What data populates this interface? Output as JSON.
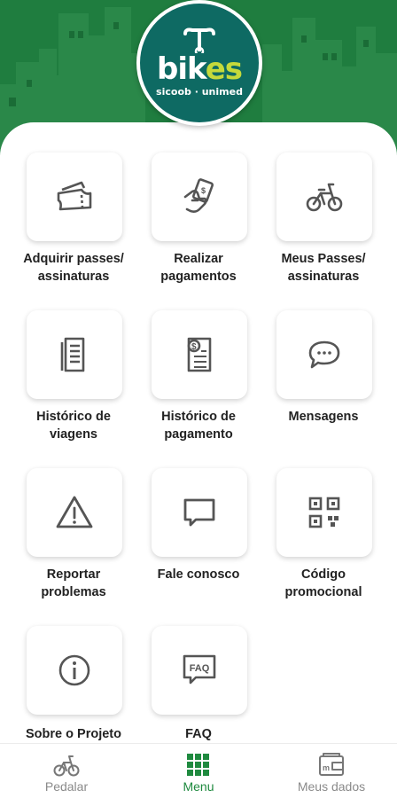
{
  "brand": {
    "logo_word_part1": "bik",
    "logo_word_part2": "es",
    "logo_subtitle": "sicoob · unimed",
    "primary_color": "#1f7d3f",
    "logo_color": "#0e6a63",
    "accent_color": "#c5d93b"
  },
  "menu": {
    "items": [
      {
        "label": "Adquirir passes/\nassinaturas",
        "icon": "ticket-icon"
      },
      {
        "label": "Realizar\npagamentos",
        "icon": "payment-hand-icon"
      },
      {
        "label": "Meus Passes/\nassinaturas",
        "icon": "bicycle-icon"
      },
      {
        "label": "Histórico de\nviagens",
        "icon": "document-icon"
      },
      {
        "label": "Histórico de\npagamento",
        "icon": "receipt-dollar-icon"
      },
      {
        "label": "Mensagens",
        "icon": "chat-bubble-icon"
      },
      {
        "label": "Reportar\nproblemas",
        "icon": "warning-icon"
      },
      {
        "label": "Fale conosco",
        "icon": "message-icon"
      },
      {
        "label": "Código\npromocional",
        "icon": "qr-code-icon"
      },
      {
        "label": "Sobre o Projeto",
        "icon": "info-icon"
      },
      {
        "label": "FAQ",
        "icon": "faq-icon"
      }
    ]
  },
  "bottom_nav": {
    "items": [
      {
        "label": "Pedalar",
        "icon": "bicycle-icon",
        "active": false
      },
      {
        "label": "Menu",
        "icon": "grid-icon",
        "active": true
      },
      {
        "label": "Meus dados",
        "icon": "wallet-card-icon",
        "active": false
      }
    ]
  }
}
